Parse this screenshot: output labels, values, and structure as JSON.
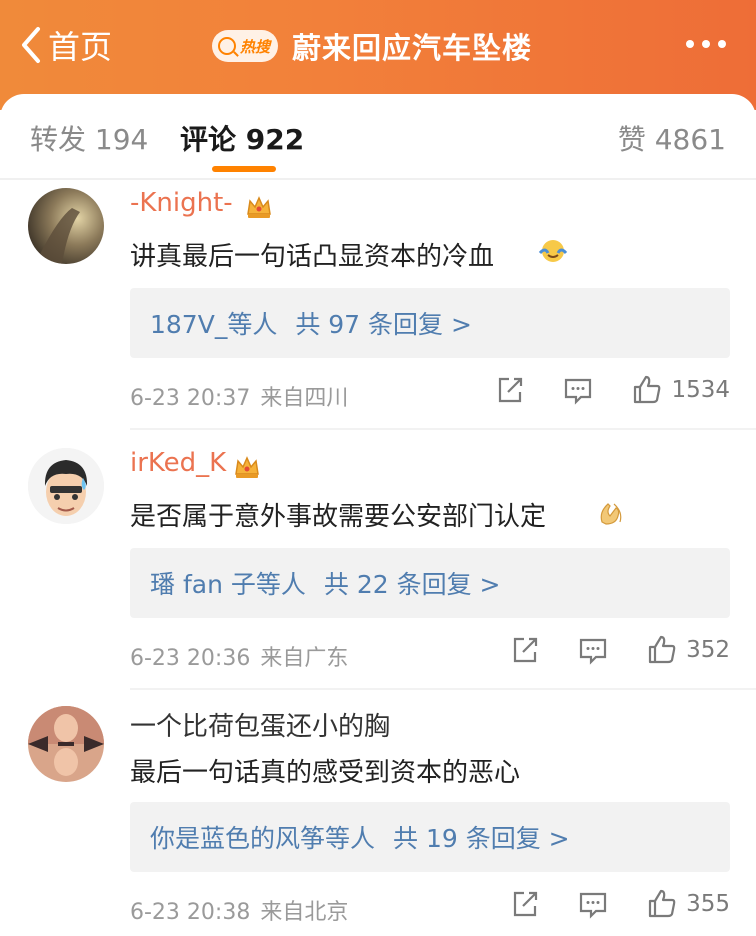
{
  "header": {
    "back_label": "首页",
    "hot_badge": "热搜",
    "title": "蔚来回应汽车坠楼"
  },
  "tabs": {
    "repost": "转发 194",
    "comment": "评论 922",
    "like": "赞 4861"
  },
  "comments": [
    {
      "username": "-Knight-",
      "text": "讲真最后一句话凸显资本的冷血",
      "replies": "187V_等人",
      "reply_count": "共 97 条回复 >",
      "time": "6-23 20:37",
      "source": "来自四川",
      "likes": "1534"
    },
    {
      "username": "irKed_K",
      "text": "是否属于意外事故需要公安部门认定",
      "replies": "璠 fan 子等人",
      "reply_count": "共 22 条回复 >",
      "time": "6-23 20:36",
      "source": "来自广东",
      "likes": "352"
    },
    {
      "username": "一个比荷包蛋还小的胸",
      "text": "最后一句话真的感受到资本的恶心",
      "replies": "你是蓝色的风筝等人",
      "reply_count": "共 19 条回复 >",
      "time": "6-23 20:38",
      "source": "来自北京",
      "likes": "355"
    }
  ],
  "colors": {
    "header_orange": "#f2813a",
    "username": "#eb7350",
    "reply_link": "#507daf",
    "tab_active_underline": "#ff8200"
  }
}
